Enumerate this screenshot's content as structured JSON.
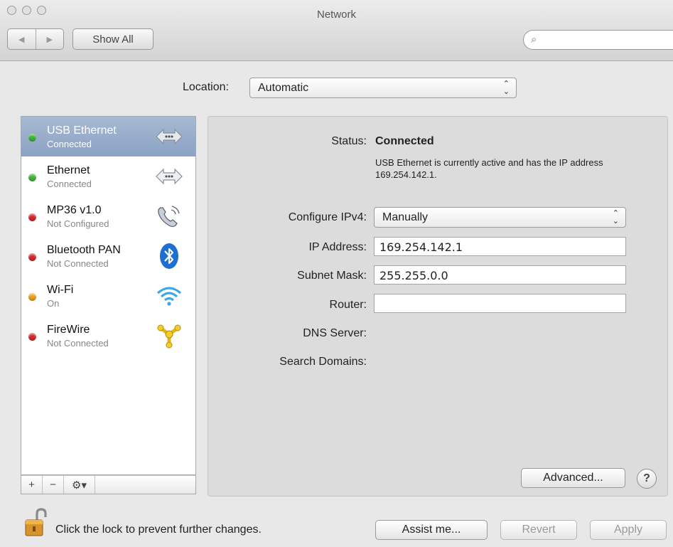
{
  "window": {
    "title": "Network"
  },
  "toolbar": {
    "back_glyph": "◀",
    "forward_glyph": "▶",
    "show_all": "Show All",
    "search_glyph": "⌕",
    "search_placeholder": ""
  },
  "location": {
    "label": "Location:",
    "value": "Automatic"
  },
  "services": [
    {
      "name": "USB Ethernet",
      "status": "Connected",
      "status_color": "#3fb83a",
      "icon": "ethernet-icon",
      "selected": true
    },
    {
      "name": "Ethernet",
      "status": "Connected",
      "status_color": "#3fb83a",
      "icon": "ethernet-icon",
      "selected": false
    },
    {
      "name": "MP36 v1.0",
      "status": "Not Configured",
      "status_color": "#d92a2a",
      "icon": "phone-icon",
      "selected": false
    },
    {
      "name": "Bluetooth PAN",
      "status": "Not Connected",
      "status_color": "#d92a2a",
      "icon": "bluetooth-icon",
      "selected": false
    },
    {
      "name": "Wi-Fi",
      "status": "On",
      "status_color": "#f0a21e",
      "icon": "wifi-icon",
      "selected": false
    },
    {
      "name": "FireWire",
      "status": "Not Connected",
      "status_color": "#d92a2a",
      "icon": "firewire-icon",
      "selected": false
    }
  ],
  "sidebar_toolbar": {
    "add": "+",
    "remove": "−",
    "action": "⚙▾"
  },
  "detail": {
    "status_label": "Status:",
    "status_value": "Connected",
    "status_description": "USB Ethernet is currently active and has the IP address 169.254.142.1.",
    "configure_label": "Configure IPv4:",
    "configure_value": "Manually",
    "ip_label": "IP Address:",
    "ip_value": "169.254.142.1",
    "subnet_label": "Subnet Mask:",
    "subnet_value": "255.255.0.0",
    "router_label": "Router:",
    "router_value": "",
    "dns_label": "DNS Server:",
    "search_domains_label": "Search Domains:",
    "advanced": "Advanced...",
    "help": "?"
  },
  "footer": {
    "lock_text": "Click the lock to prevent further changes.",
    "assist": "Assist me...",
    "revert": "Revert",
    "apply": "Apply"
  },
  "colors": {
    "selection": "#8ba2c4",
    "accent_blue": "#1f6fd0"
  }
}
